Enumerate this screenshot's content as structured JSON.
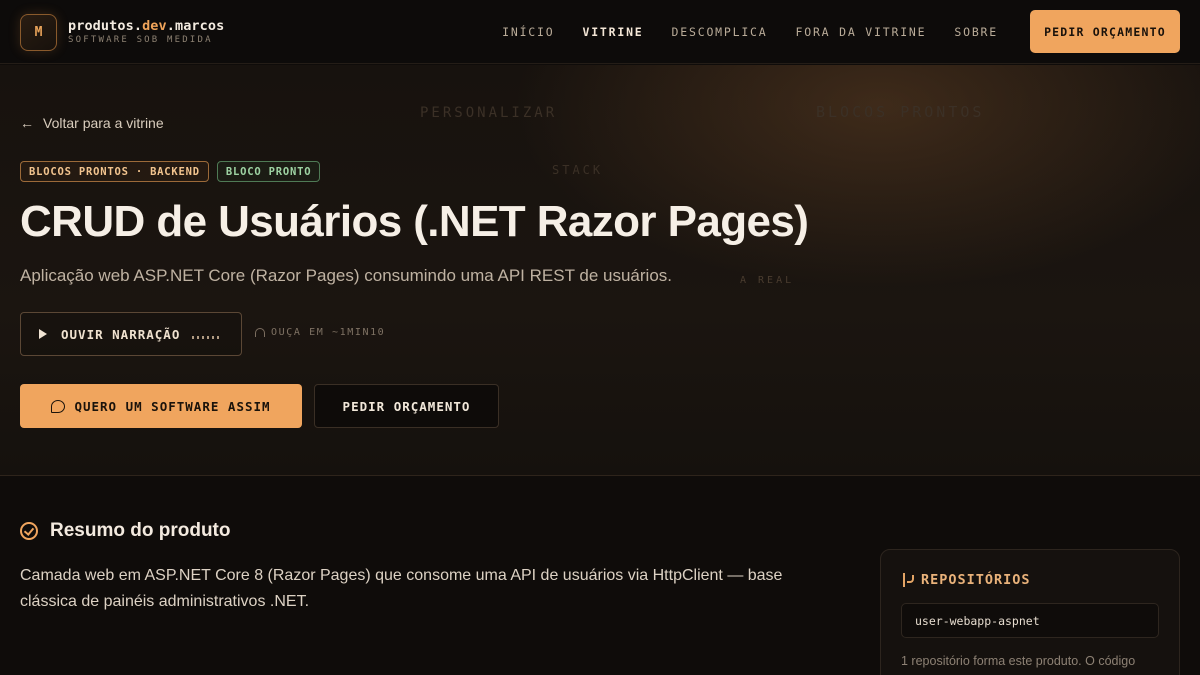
{
  "header": {
    "logo_letter": "M",
    "brand_prefix": "produtos.",
    "brand_accent": "dev",
    "brand_suffix": ".marcos",
    "tagline": "SOFTWARE SOB MEDIDA",
    "nav": [
      "INÍCIO",
      "VITRINE",
      "DESCOMPLICA",
      "FORA DA VITRINE",
      "SOBRE"
    ],
    "active_nav": "VITRINE",
    "cta_label": "PEDIR ORÇAMENTO"
  },
  "hero": {
    "background_words": [
      "PERSONALIZAR",
      "BLOCOS PRONTOS",
      "STACK",
      "A REAL"
    ],
    "back_label": "Voltar para a vitrine",
    "badges": [
      "BLOCOS PRONTOS · BACKEND",
      "BLOCO PRONTO"
    ],
    "title": "CRUD de Usuários (.NET Razor Pages)",
    "subtitle": "Aplicação web ASP.NET Core (Razor Pages) consumindo uma API REST de usuários.",
    "narration_label": "OUVIR NARRAÇÃO",
    "listen_label": "OUÇA EM ~1MIN10",
    "primary_cta": "QUERO UM SOFTWARE ASSIM",
    "secondary_cta": "PEDIR ORÇAMENTO"
  },
  "summary": {
    "title": "Resumo do produto",
    "text": "Camada web em ASP.NET Core 8 (Razor Pages) que consome uma API de usuários via HttpClient — base clássica de painéis administrativos .NET."
  },
  "repositories": {
    "title": "REPOSITÓRIOS",
    "items": [
      "user-webapp-aspnet"
    ],
    "note": "1 repositório forma este produto. O código"
  },
  "colors": {
    "accent": "#f0a55e",
    "background": "#0f0c0a",
    "badge_green": "#9ed3a3"
  }
}
